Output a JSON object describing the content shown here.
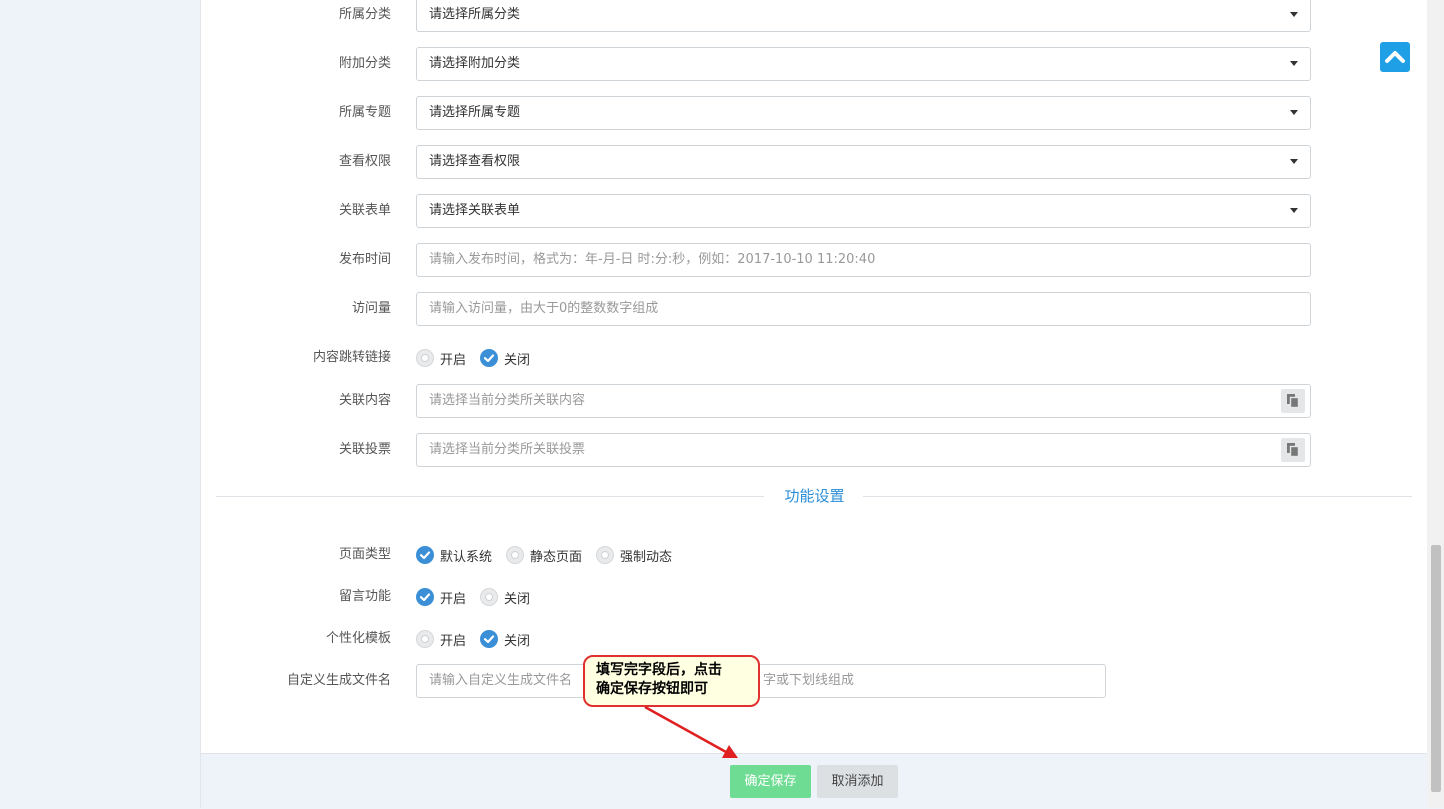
{
  "form": {
    "category": {
      "label": "所属分类",
      "value": "请选择所属分类"
    },
    "extra_category": {
      "label": "附加分类",
      "value": "请选择附加分类"
    },
    "topic": {
      "label": "所属专题",
      "value": "请选择所属专题"
    },
    "view_permission": {
      "label": "查看权限",
      "value": "请选择查看权限"
    },
    "related_form": {
      "label": "关联表单",
      "value": "请选择关联表单"
    },
    "publish_time": {
      "label": "发布时间",
      "placeholder": "请输入发布时间，格式为：年-月-日 时:分:秒，例如：2017-10-10 11:20:40"
    },
    "visits": {
      "label": "访问量",
      "placeholder": "请输入访问量，由大于0的整数数字组成"
    },
    "redirect_link": {
      "label": "内容跳转链接",
      "options": [
        "开启",
        "关闭"
      ],
      "selected": "关闭"
    },
    "related_content": {
      "label": "关联内容",
      "placeholder": "请选择当前分类所关联内容",
      "picker_icon": "copy-icon"
    },
    "related_vote": {
      "label": "关联投票",
      "placeholder": "请选择当前分类所关联投票",
      "picker_icon": "copy-icon"
    }
  },
  "section": {
    "title": "功能设置"
  },
  "features": {
    "page_type": {
      "label": "页面类型",
      "options": [
        "默认系统",
        "静态页面",
        "强制动态"
      ],
      "selected": "默认系统"
    },
    "comments": {
      "label": "留言功能",
      "options": [
        "开启",
        "关闭"
      ],
      "selected": "开启"
    },
    "custom_template": {
      "label": "个性化模板",
      "options": [
        "开启",
        "关闭"
      ],
      "selected": "关闭"
    },
    "custom_filename": {
      "label": "自定义生成文件名",
      "placeholder_start": "请输入自定义生成文件名",
      "placeholder_end": "字或下划线组成"
    }
  },
  "footer": {
    "save_label": "确定保存",
    "cancel_label": "取消添加"
  },
  "tooltip": {
    "line1": "填写完字段后，点击",
    "line2": "确定保存按钮即可"
  },
  "back_to_top": {
    "icon": "chevron-up-icon"
  },
  "colors": {
    "accent": "#2c8ed6",
    "save_button": "#6fdc94",
    "callout_border": "#e03030",
    "callout_bg": "#ffffe1"
  }
}
